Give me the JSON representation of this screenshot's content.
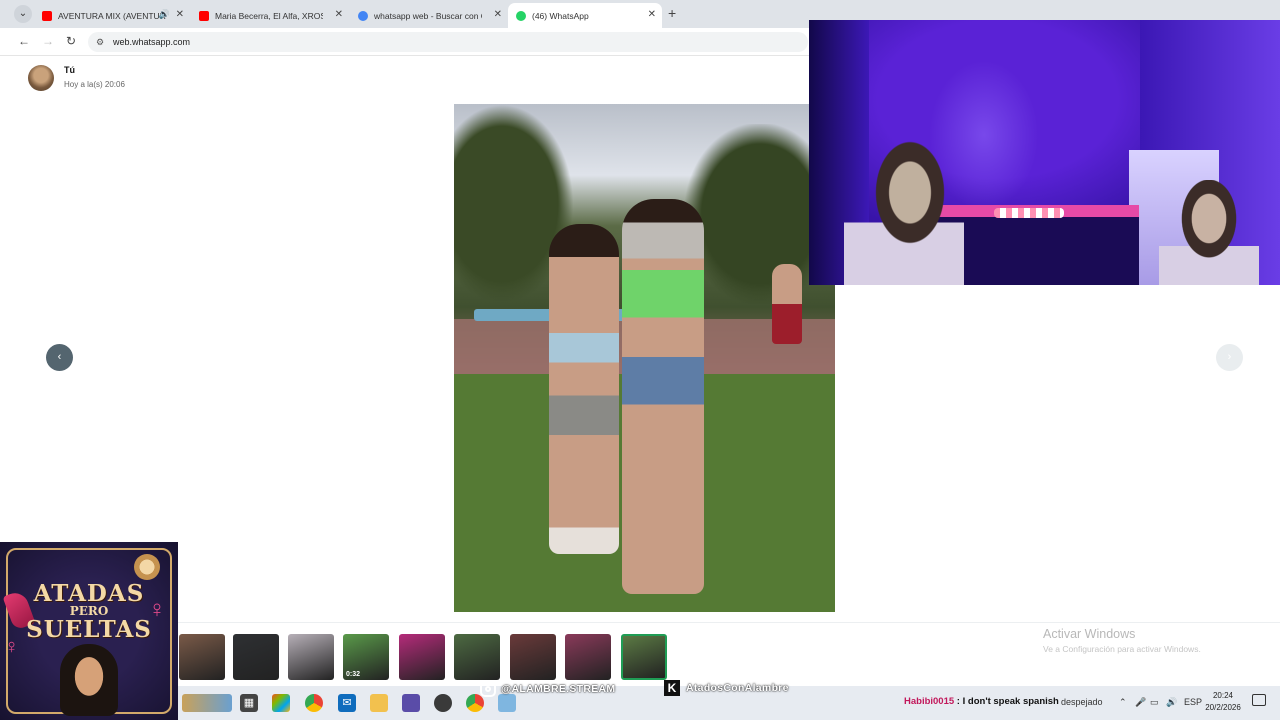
{
  "browser": {
    "tabs": [
      {
        "title": "AVENTURA MIX (AVENTURA",
        "favicon_color": "#ff0000",
        "sound": true,
        "active": false
      },
      {
        "title": "Maria Becerra, El Alfa, XROSS -",
        "favicon_color": "#ff0000",
        "sound": false,
        "active": false
      },
      {
        "title": "whatsapp web - Buscar con Go",
        "favicon_color": "#4285f4",
        "sound": false,
        "active": false
      },
      {
        "title": "(46) WhatsApp",
        "favicon_color": "#25d366",
        "sound": false,
        "active": true
      }
    ],
    "url": "web.whatsapp.com"
  },
  "viewer": {
    "sender_name": "Tú",
    "sender_time": "Hoy a la(s) 20:06",
    "thumbnails": [
      {
        "color": "#7a5a48",
        "duration": "",
        "selected": false
      },
      {
        "color": "#2e3033",
        "duration": "",
        "selected": false
      },
      {
        "color": "#b7b0b8",
        "duration": "",
        "selected": false
      },
      {
        "color": "#5a9a4a",
        "duration": "0:32",
        "selected": false
      },
      {
        "color": "#b52b7a",
        "duration": "",
        "selected": false
      },
      {
        "color": "#4d6a42",
        "duration": "",
        "selected": false
      },
      {
        "color": "#6a3a3a",
        "duration": "",
        "selected": false
      },
      {
        "color": "#8a3a5a",
        "duration": "",
        "selected": false
      },
      {
        "color": "#5b7a44",
        "duration": "",
        "selected": true
      }
    ]
  },
  "windows": {
    "activate_title": "Activar Windows",
    "activate_sub": "Ve a Configuración para activar Windows."
  },
  "logo": {
    "line1": "ATADAS",
    "line2": "PERO",
    "line3": "SUELTAS"
  },
  "stream": {
    "instagram": "@ALAMBRE.STREAM",
    "kick": "AtadosConAlambre"
  },
  "chat": {
    "user": "Habibi0015",
    "separator": " : ",
    "message": "I don't speak spanish"
  },
  "taskbar": {
    "weather": "despejado",
    "lang": "ESP",
    "time": "20:24",
    "date": "20/2/2026"
  }
}
